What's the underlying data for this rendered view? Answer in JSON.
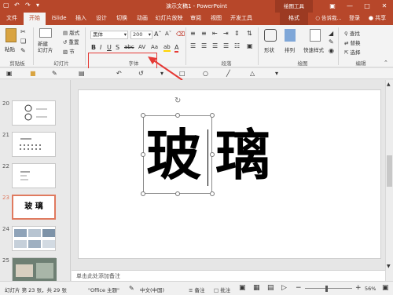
{
  "app": {
    "window_title": "演示文稿1 - PowerPoint",
    "context_tab_group": "绘图工具"
  },
  "tabs": [
    {
      "label": "文件"
    },
    {
      "label": "开始"
    },
    {
      "label": "iSlide"
    },
    {
      "label": "插入"
    },
    {
      "label": "设计"
    },
    {
      "label": "切换"
    },
    {
      "label": "动画"
    },
    {
      "label": "幻灯片放映"
    },
    {
      "label": "审阅"
    },
    {
      "label": "视图"
    },
    {
      "label": "开发工具"
    },
    {
      "label": "格式"
    }
  ],
  "tell_me": "告诉我...",
  "login": "登录",
  "share": "共享",
  "ribbon": {
    "clipboard": {
      "paste": "粘贴",
      "label": "剪贴板"
    },
    "slides": {
      "new_slide": "新建\n幻灯片",
      "layout": "版式",
      "reset": "重置",
      "section": "节",
      "label": "幻灯片"
    },
    "font": {
      "font_name": "黑体",
      "font_size": "200",
      "label": "字体"
    },
    "paragraph": {
      "label": "段落"
    },
    "drawing": {
      "shapes": "形状",
      "arrange": "排列",
      "quick_styles": "快速样式",
      "label": "绘图"
    },
    "editing": {
      "find": "查找",
      "replace": "替换",
      "select": "选择",
      "label": "编辑"
    }
  },
  "slides": [
    {
      "num": "20"
    },
    {
      "num": "21"
    },
    {
      "num": "22"
    },
    {
      "num": "23",
      "text": "玻 璃",
      "selected": true
    },
    {
      "num": "24"
    },
    {
      "num": "25"
    }
  ],
  "slide": {
    "char1": "玻",
    "char2": "璃"
  },
  "notes_placeholder": "单击此处添加备注",
  "status": {
    "slide_info": "幻灯片 第 23 张，共 29 张",
    "theme": "\"Office 主题\"",
    "language": "中文(中国)",
    "notes": "备注",
    "comments": "批注",
    "zoom": "56%"
  },
  "colors": {
    "accent": "#b7472a",
    "highlight": "#e53935"
  }
}
